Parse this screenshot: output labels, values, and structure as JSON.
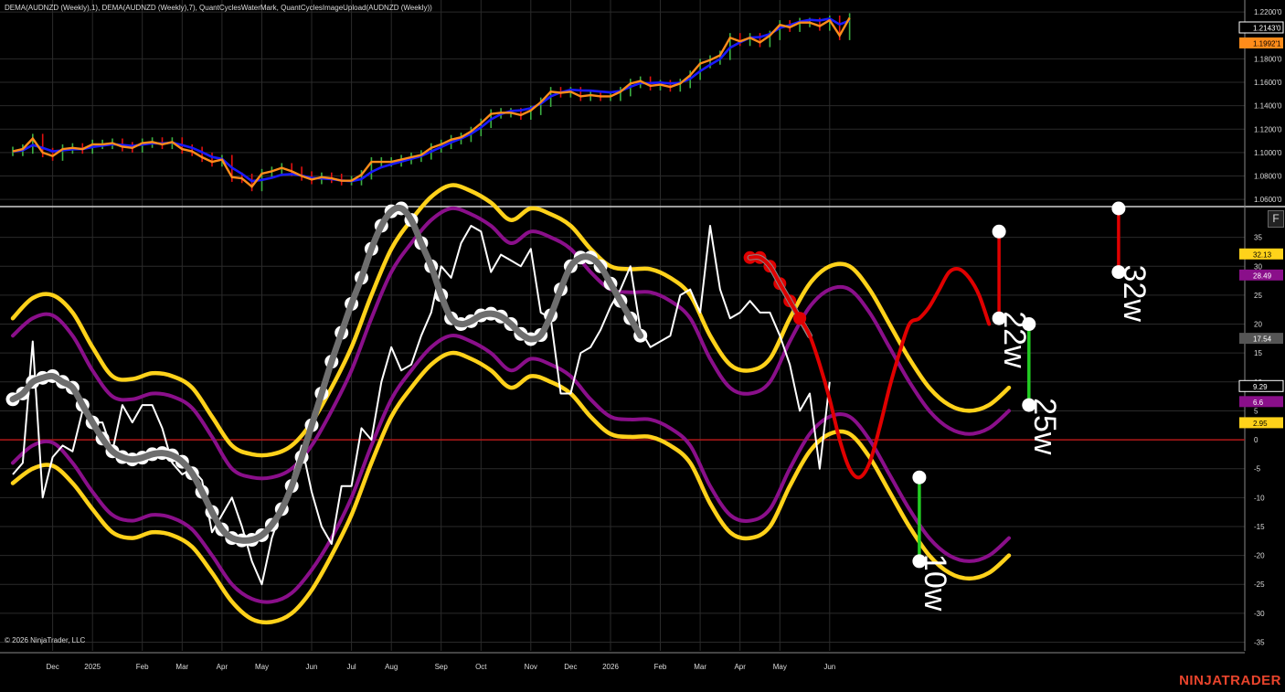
{
  "header": {
    "indicators": "DEMA(AUDNZD (Weekly),1), DEMA(AUDNZD (Weekly),7), QuantCyclesWaterMark, QuantCyclesImageUpload(AUDNZD (Weekly))"
  },
  "footer": {
    "copyright": "© 2026 NinjaTrader, LLC",
    "brand": "NINJATRADER"
  },
  "f_button": "F",
  "colors": {
    "background": "#000000",
    "grid": "#2a2a2a",
    "candle_up": "#3cb043",
    "candle_down": "#e01010",
    "dema_fast": "#ff8c1a",
    "dema_slow": "#1a1aff",
    "band_outer": "#ffd21a",
    "band_inner": "#8a0f8a",
    "cycle_projection": "#e00000",
    "oscillator": "#ffffff",
    "smoothed": "#6e6e6e",
    "zero_line": "#b01818"
  },
  "chart_data": [
    {
      "type": "line",
      "panel": "price",
      "title": "",
      "price_labels": {
        "last": "1.2143'0",
        "dema": "1.1992'1"
      },
      "yticks": [
        "1.2200'0",
        "1.1800'0",
        "1.1600'0",
        "1.1400'0",
        "1.1200'0",
        "1.1000'0",
        "1.0800'0",
        "1.0600'0"
      ],
      "ytick_values": [
        1.22,
        1.18,
        1.16,
        1.14,
        1.12,
        1.1,
        1.08,
        1.06
      ],
      "ylim": [
        1.057,
        1.224
      ],
      "x_week": [
        0,
        1,
        2,
        3,
        4,
        5,
        6,
        7,
        8,
        9,
        10,
        11,
        12,
        13,
        14,
        15,
        16,
        17,
        18,
        19,
        20,
        21,
        22,
        23,
        24,
        25,
        26,
        27,
        28,
        29,
        30,
        31,
        32,
        33,
        34,
        35,
        36,
        37,
        38,
        39,
        40,
        41,
        42,
        43,
        44,
        45,
        46,
        47,
        48,
        49,
        50,
        51,
        52,
        53,
        54,
        55,
        56,
        57,
        58,
        59,
        60,
        61,
        62,
        63,
        64,
        65,
        66,
        67,
        68,
        69,
        70,
        71,
        72,
        73,
        74,
        75,
        76,
        77,
        78,
        79,
        80,
        81,
        82,
        83,
        84
      ],
      "close": [
        1.101,
        1.103,
        1.112,
        1.1,
        1.097,
        1.103,
        1.104,
        1.103,
        1.107,
        1.107,
        1.108,
        1.105,
        1.104,
        1.108,
        1.109,
        1.107,
        1.109,
        1.103,
        1.101,
        1.096,
        1.092,
        1.094,
        1.079,
        1.078,
        1.071,
        1.082,
        1.084,
        1.087,
        1.084,
        1.08,
        1.077,
        1.079,
        1.078,
        1.076,
        1.076,
        1.081,
        1.092,
        1.092,
        1.092,
        1.094,
        1.096,
        1.098,
        1.104,
        1.107,
        1.111,
        1.113,
        1.118,
        1.125,
        1.133,
        1.134,
        1.134,
        1.132,
        1.136,
        1.143,
        1.152,
        1.151,
        1.152,
        1.148,
        1.149,
        1.148,
        1.148,
        1.152,
        1.159,
        1.161,
        1.157,
        1.158,
        1.156,
        1.159,
        1.166,
        1.176,
        1.179,
        1.183,
        1.198,
        1.195,
        1.198,
        1.194,
        1.2,
        1.209,
        1.207,
        1.211,
        1.211,
        1.208,
        1.213,
        1.2,
        1.215
      ],
      "dema_fast_name": "",
      "dema_slow_name": ""
    },
    {
      "type": "line",
      "panel": "cycles",
      "title": "",
      "yticks": [
        35,
        30,
        25,
        20,
        15,
        10,
        5,
        0,
        -5,
        -10,
        -15,
        -20,
        -25,
        -30,
        -35
      ],
      "ylim": [
        -36.5,
        40
      ],
      "value_labels": [
        "32.13",
        "28.49",
        "17.54",
        "9.29",
        "6.6",
        "2.95"
      ],
      "x_labels": [
        "Dec",
        "2025",
        "Feb",
        "Mar",
        "Apr",
        "May",
        "Jun",
        "Jul",
        "Aug",
        "Sep",
        "Oct",
        "Nov",
        "Dec",
        "2026",
        "Feb",
        "Mar",
        "Apr",
        "May",
        "Jun"
      ],
      "x_label_weeks": [
        4,
        8,
        13,
        17,
        21,
        25,
        30,
        34,
        38,
        43,
        47,
        52,
        56,
        60,
        65,
        69,
        73,
        77,
        82
      ],
      "oscillator": [
        -6,
        -4,
        17,
        -10,
        -3,
        -1,
        -2,
        5,
        3,
        3,
        -2,
        6,
        3,
        6,
        6,
        2,
        -4,
        -6,
        -5,
        -7,
        -16,
        -13,
        -10,
        -15,
        -21,
        -25,
        -17,
        -12,
        -7,
        -1,
        -9,
        -15,
        -18,
        -8,
        -8,
        2,
        0,
        10,
        16,
        12,
        13,
        18,
        22,
        30,
        28,
        34,
        37,
        36,
        29,
        32,
        31,
        30,
        33,
        22,
        21,
        8,
        8,
        15,
        16,
        19,
        23,
        26,
        30,
        19,
        16,
        17,
        18,
        25,
        26,
        22,
        37,
        26,
        21,
        22,
        24,
        22,
        22,
        18,
        13,
        5,
        8,
        -5,
        10
      ],
      "smoothed": [
        7,
        8,
        10,
        10.7,
        11,
        10,
        9,
        6,
        3,
        0.2,
        -2,
        -3,
        -3.4,
        -3.1,
        -2.5,
        -2.3,
        -2.7,
        -3.8,
        -5.8,
        -9,
        -12.5,
        -15.5,
        -17,
        -17.4,
        -17.3,
        -16.5,
        -14.7,
        -12,
        -8,
        -3,
        2.5,
        8,
        13.5,
        18.5,
        23.5,
        28,
        33,
        37,
        39.5,
        40,
        38,
        34,
        30,
        25,
        21,
        20,
        20.5,
        21.5,
        21.8,
        21.3,
        20,
        18.3,
        17.4,
        18.1,
        21.5,
        26,
        30,
        31.5,
        31.5,
        30,
        27,
        24,
        21,
        18
      ],
      "smoothed_start_week": 0,
      "projection": [
        31.5,
        31.5,
        30,
        27,
        24,
        21,
        18,
        13,
        7,
        0,
        -5,
        -6.5,
        -4,
        2,
        9,
        15,
        20,
        21,
        23,
        26,
        29,
        29.5,
        28,
        25,
        20
      ],
      "projection_start_week": 74,
      "bands": {
        "outer_upper": [
          21,
          24.5,
          25,
          22,
          16,
          11,
          10.5,
          11.5,
          11,
          9,
          4,
          -1,
          -2.5,
          -2.5,
          -1,
          3,
          9,
          16,
          25,
          33,
          38,
          42,
          44,
          43,
          41,
          38,
          40,
          39,
          37,
          33,
          30,
          29.5,
          29.5,
          28,
          25,
          18,
          13,
          12,
          14,
          21,
          27,
          30,
          30,
          26,
          20,
          14,
          9,
          6,
          5,
          6,
          9
        ],
        "inner_upper": [
          18,
          21,
          21.5,
          18,
          12,
          7.5,
          7,
          8,
          7.5,
          5.5,
          0.5,
          -5,
          -6.5,
          -6.5,
          -5,
          -1,
          5,
          12,
          21,
          29,
          34,
          38,
          40,
          39,
          37,
          34,
          36,
          35,
          33,
          29,
          26,
          25.5,
          25.5,
          24,
          21,
          14,
          9,
          8,
          10,
          17,
          23,
          26,
          26,
          22,
          16,
          10,
          5,
          2,
          1,
          2,
          5
        ],
        "inner_lower": [
          -4,
          -1,
          -0.5,
          -4,
          -9,
          -13,
          -14,
          -13,
          -13.5,
          -15.5,
          -20,
          -25,
          -27.5,
          -28,
          -26.5,
          -22.5,
          -17,
          -10,
          -1,
          7,
          12,
          16,
          18,
          17,
          15,
          12,
          14,
          13,
          11,
          7,
          4,
          3.5,
          3.5,
          2,
          -1,
          -8,
          -13,
          -14,
          -12,
          -5,
          1,
          4,
          4,
          0,
          -6,
          -12,
          -17,
          -20,
          -21,
          -20,
          -17
        ],
        "outer_lower": [
          -7.5,
          -5,
          -4.5,
          -7.5,
          -12,
          -16,
          -17,
          -16,
          -16.5,
          -18.5,
          -23,
          -28,
          -31,
          -31.5,
          -30,
          -26,
          -20,
          -13,
          -4,
          4,
          9,
          13,
          15,
          14,
          12,
          9,
          11,
          10,
          8,
          4,
          1,
          0.5,
          0.5,
          -1,
          -4,
          -11,
          -16,
          -17,
          -15,
          -8,
          -2,
          1,
          1,
          -3,
          -9,
          -15,
          -20,
          -23,
          -24,
          -23,
          -20
        ],
        "band_step_weeks": 2
      },
      "cycle_markers": [
        {
          "label": "10w",
          "week": 91,
          "from": -6.5,
          "to": -21,
          "color": "#22cc22"
        },
        {
          "label": "22w",
          "week": 99,
          "from": 36,
          "to": 21,
          "color": "#e00000"
        },
        {
          "label": "25w",
          "week": 102,
          "from": 20,
          "to": 6,
          "color": "#22cc22"
        },
        {
          "label": "32w",
          "week": 111,
          "from": 40,
          "to": 29,
          "color": "#e00000"
        }
      ]
    }
  ]
}
